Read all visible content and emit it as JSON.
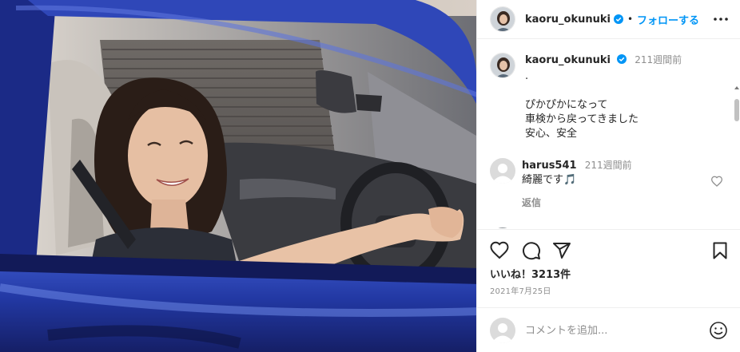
{
  "post": {
    "image_alt": "woman smiling in driver's seat of a blue car",
    "author": "kaoru_okunuki",
    "verified": true
  },
  "header": {
    "username": "kaoru_okunuki",
    "separator": "•",
    "follow_label": "フォローする"
  },
  "caption": {
    "username": "kaoru_okunuki",
    "time": "211週間前",
    "lines": [
      ".",
      "",
      "ぴかぴかになって",
      "車検から戻ってきました",
      "安心、安全"
    ]
  },
  "comments": [
    {
      "username": "harus541",
      "time": "211週間前",
      "text": "綺麗です🎵",
      "reply_label": "返信"
    }
  ],
  "stats": {
    "likes_label": "いいね！3213件",
    "date": "2021年7月25日"
  },
  "add_comment": {
    "placeholder": "コメントを追加..."
  },
  "colors": {
    "accent": "#0095f6",
    "verified": "#0095f6",
    "text": "#262626",
    "muted": "#8e8e8e",
    "car_blue": "#2a3fa8"
  }
}
